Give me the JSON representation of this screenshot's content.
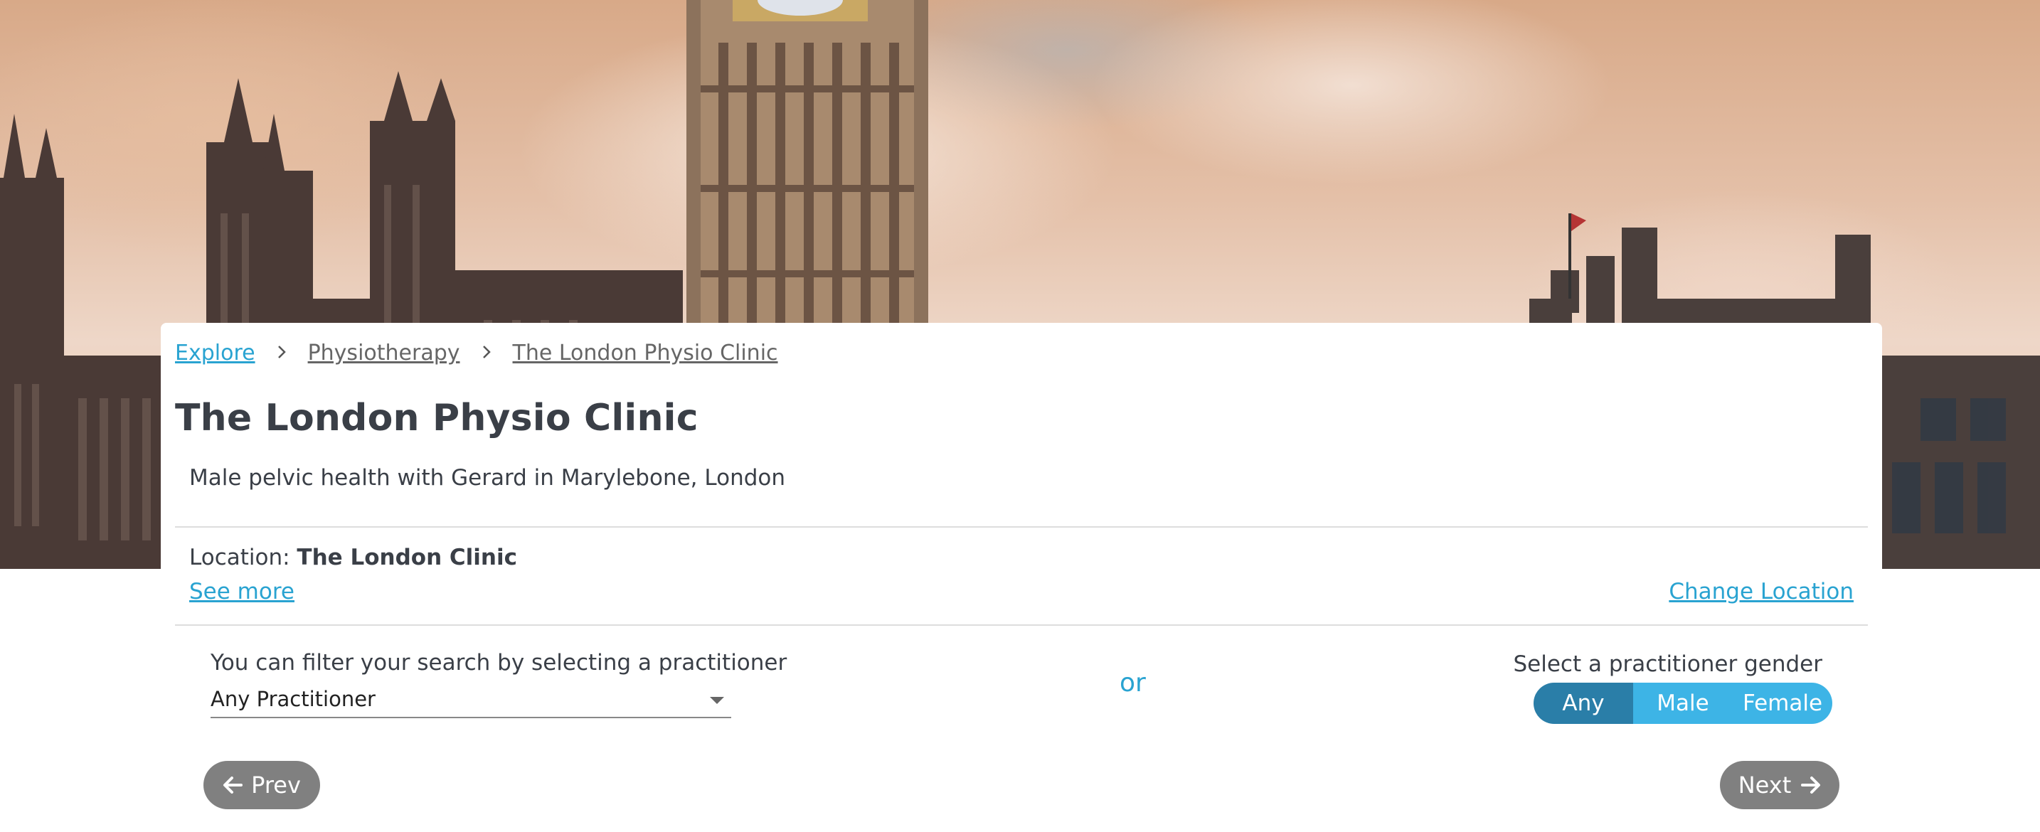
{
  "breadcrumb": {
    "items": [
      "Explore",
      "Physiotherapy",
      "The London Physio Clinic"
    ]
  },
  "clinic": {
    "title": "The London Physio Clinic",
    "subtitle": "Male pelvic health with Gerard in Marylebone, London"
  },
  "location": {
    "prefix": "Location:",
    "name": "The London Clinic",
    "see_more": "See more",
    "change": "Change Location"
  },
  "filter": {
    "label": "You can filter your search by selecting a practitioner",
    "selected": "Any Practitioner",
    "or": "or",
    "gender_label": "Select a practitioner gender",
    "gender_options": [
      "Any",
      "Male",
      "Female"
    ],
    "gender_selected": "Any"
  },
  "nav": {
    "prev": "Prev",
    "next": "Next"
  },
  "colors": {
    "link": "#29a3d1",
    "gender_active": "#2a7ea8",
    "gender_inactive": "#3db4e6",
    "nav_button": "#808080"
  }
}
